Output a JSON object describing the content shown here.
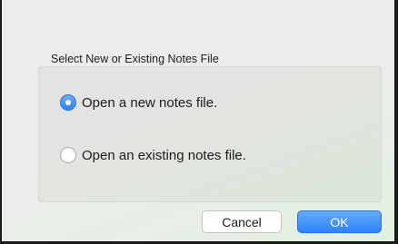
{
  "dialog": {
    "group_title": "Select New or Existing Notes File",
    "options": [
      {
        "label": "Open a new notes file.",
        "selected": true
      },
      {
        "label": "Open an existing notes file.",
        "selected": false
      }
    ],
    "buttons": {
      "cancel_label": "Cancel",
      "ok_label": "OK"
    }
  },
  "colors": {
    "accent": "#2f7ef5",
    "window_bg": "#ececec",
    "group_bg": "#e2e4e0"
  },
  "icons": {
    "selected_radio": "radio-checked-icon",
    "unselected_radio": "radio-unchecked-icon"
  }
}
